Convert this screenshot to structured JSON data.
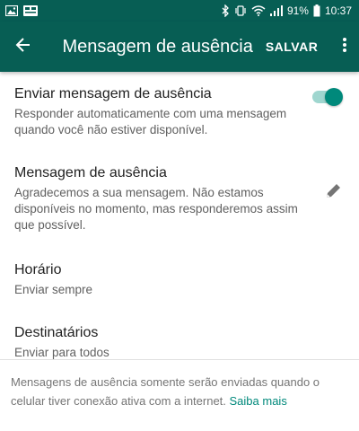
{
  "status_bar": {
    "battery_percent": "91%",
    "time": "10:37",
    "left_icons": [
      "gallery-icon",
      "notification-icon"
    ],
    "right_icons": [
      "bluetooth-icon",
      "vibrate-icon",
      "wifi-icon",
      "signal-icon",
      "battery-icon"
    ]
  },
  "app_bar": {
    "back_icon": "arrow-back-icon",
    "title": "Mensagem de ausência",
    "save_label": "SALVAR",
    "overflow_icon": "more-vert-icon"
  },
  "settings": {
    "send_away": {
      "title": "Enviar mensagem de ausência",
      "subtitle": "Responder automaticamente com uma mensagem quando você não estiver disponível.",
      "enabled": true
    },
    "away_message": {
      "title": "Mensagem de ausência",
      "subtitle": "Agradecemos a sua mensagem. Não estamos disponíveis no momento, mas responderemos assim que possível.",
      "edit_icon": "pencil-icon"
    },
    "schedule": {
      "title": "Horário",
      "subtitle": "Enviar sempre"
    },
    "recipients": {
      "title": "Destinatários",
      "subtitle": "Enviar para todos"
    }
  },
  "footer": {
    "text": "Mensagens de ausência somente serão enviadas quando o celular tiver conexão ativa com a internet. ",
    "link": "Saiba mais"
  },
  "colors": {
    "primary": "#075e54",
    "accent": "#00897b",
    "toggle_track": "#9fd6cf",
    "on_primary": "#ffffff"
  }
}
